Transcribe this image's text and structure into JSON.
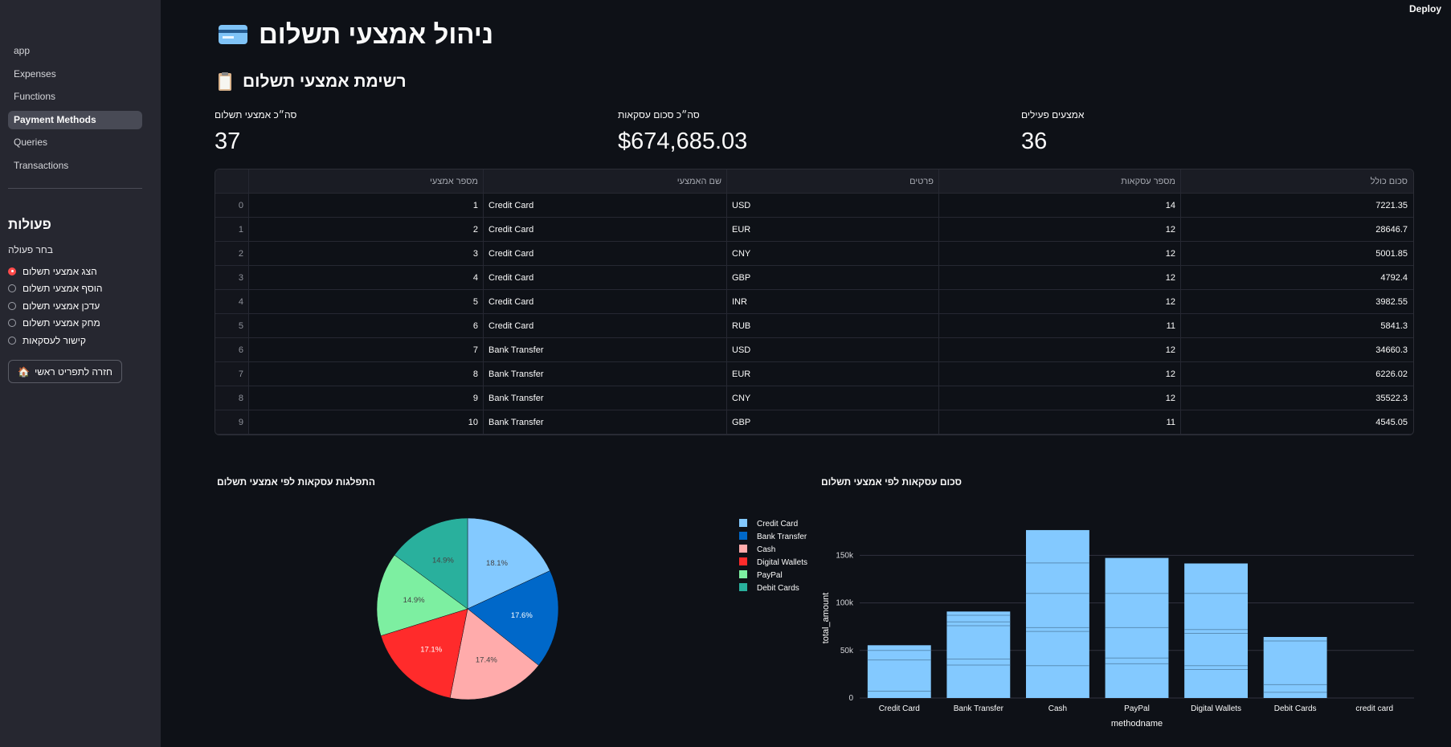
{
  "header": {
    "deploy_label": "Deploy"
  },
  "sidebar": {
    "nav": [
      "app",
      "Expenses",
      "Functions",
      "Payment Methods",
      "Queries",
      "Transactions"
    ],
    "active_index": 3,
    "section_title": "פעולות",
    "radio_label": "בחר פעולה",
    "radio_options": [
      "הצג אמצעי תשלום",
      "הוסף אמצעי תשלום",
      "עדכן אמצעי תשלום",
      "מחק אמצעי תשלום",
      "קישור לעסקאות"
    ],
    "selected_option": 0,
    "home_button": "חזרה לתפריט ראשי",
    "home_icon": "house-icon"
  },
  "page": {
    "title": "ניהול אמצעי תשלום",
    "title_icon": "credit-card-icon",
    "subtitle": "רשימת אמצעי תשלום",
    "subtitle_icon": "clipboard-icon"
  },
  "metrics": [
    {
      "label": "סה״כ אמצעי תשלום",
      "value": "37"
    },
    {
      "label": "סה״כ סכום עסקאות",
      "value": "$674,685.03"
    },
    {
      "label": "אמצעים פעילים",
      "value": "36"
    }
  ],
  "table": {
    "headers": [
      "מספר אמצעי",
      "שם האמצעי",
      "פרטים",
      "מספר עסקאות",
      "סכום כולל"
    ],
    "rows": [
      [
        "0",
        "1",
        "Credit Card",
        "USD",
        "14",
        "7221.35"
      ],
      [
        "1",
        "2",
        "Credit Card",
        "EUR",
        "12",
        "28646.7"
      ],
      [
        "2",
        "3",
        "Credit Card",
        "CNY",
        "12",
        "5001.85"
      ],
      [
        "3",
        "4",
        "Credit Card",
        "GBP",
        "12",
        "4792.4"
      ],
      [
        "4",
        "5",
        "Credit Card",
        "INR",
        "12",
        "3982.55"
      ],
      [
        "5",
        "6",
        "Credit Card",
        "RUB",
        "11",
        "5841.3"
      ],
      [
        "6",
        "7",
        "Bank Transfer",
        "USD",
        "12",
        "34660.3"
      ],
      [
        "7",
        "8",
        "Bank Transfer",
        "EUR",
        "12",
        "6226.02"
      ],
      [
        "8",
        "9",
        "Bank Transfer",
        "CNY",
        "12",
        "35522.3"
      ],
      [
        "9",
        "10",
        "Bank Transfer",
        "GBP",
        "11",
        "4545.05"
      ]
    ]
  },
  "chart_data": [
    {
      "type": "pie",
      "title": "התפלגות עסקאות לפי אמצעי תשלום",
      "labels": [
        "Credit Card",
        "Bank Transfer",
        "Cash",
        "Digital Wallets",
        "PayPal",
        "Debit Cards"
      ],
      "values": [
        18.1,
        17.6,
        17.4,
        17.1,
        14.9,
        14.9
      ],
      "value_labels": [
        "18.1%",
        "17.6%",
        "17.4%",
        "17.1%",
        "14.9%",
        "14.9%"
      ],
      "colors": [
        "#83c9ff",
        "#0068c9",
        "#ffabab",
        "#ff2b2b",
        "#7defa1",
        "#29b09d"
      ],
      "legend_position": "right"
    },
    {
      "type": "bar",
      "title": "סכום עסקאות לפי אמצעי תשלום",
      "xlabel": "methodname",
      "ylabel": "total_amount",
      "categories": [
        "Credit Card",
        "Bank Transfer",
        "Cash",
        "PayPal",
        "Digital Wallets",
        "Debit Cards",
        "credit card"
      ],
      "values": [
        55486,
        90954,
        176600,
        147300,
        141500,
        64200,
        0
      ],
      "segment_breaks": [
        [
          7221,
          40000,
          50000
        ],
        [
          34660,
          41000,
          76000,
          80000,
          87000
        ],
        [
          34000,
          70000,
          74000,
          110000,
          142000
        ],
        [
          36000,
          42000,
          74000,
          110000
        ],
        [
          30000,
          34000,
          68000,
          72000,
          110000
        ],
        [
          6000,
          14000,
          60000
        ],
        []
      ],
      "yticks": [
        0,
        50000,
        100000,
        150000
      ],
      "ytick_labels": [
        "0",
        "50k",
        "100k",
        "150k"
      ],
      "ylim": [
        0,
        185000
      ],
      "bar_color": "#83c9ff"
    }
  ]
}
